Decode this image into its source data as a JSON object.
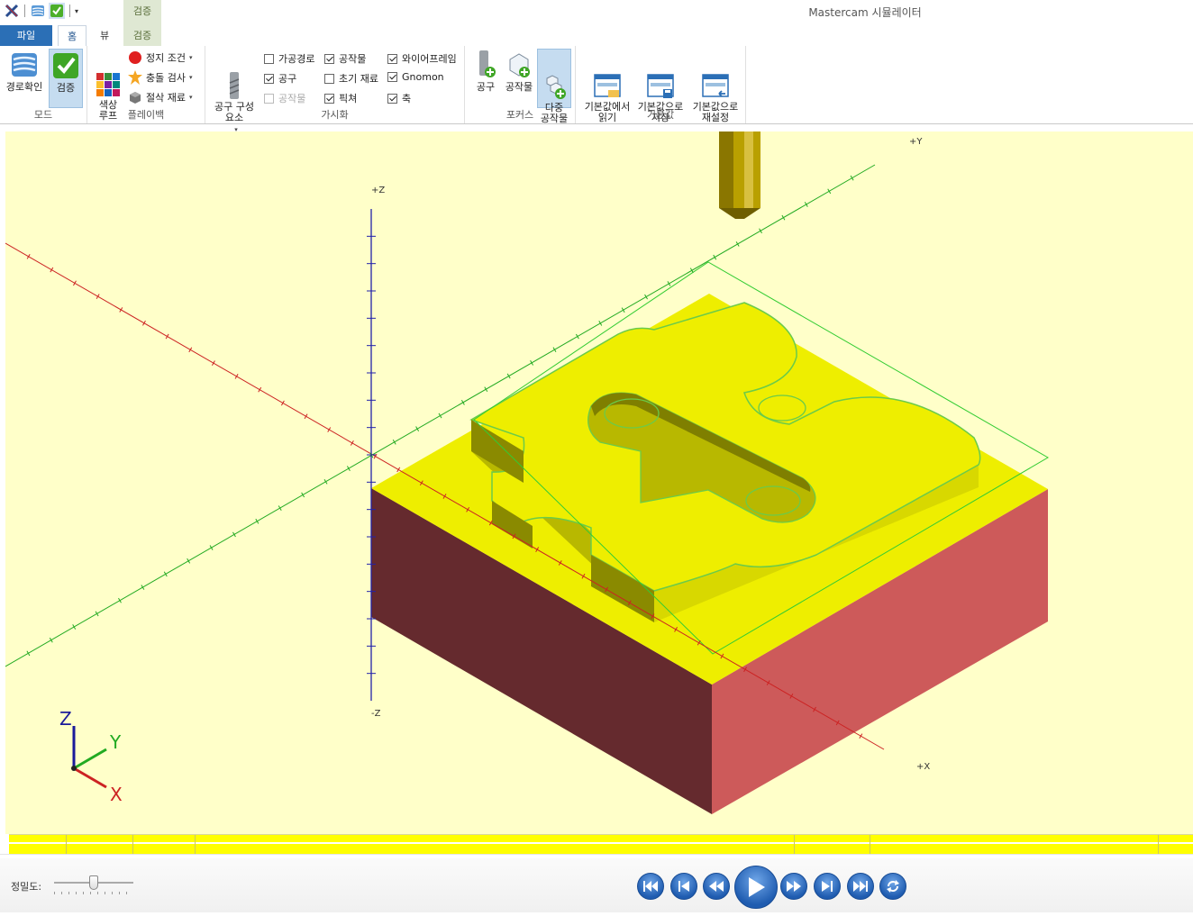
{
  "window": {
    "title": "Mastercam 시뮬레이터",
    "context_tab_header": "검증"
  },
  "tabs": [
    {
      "label": "파일"
    },
    {
      "label": "홈"
    },
    {
      "label": "뷰"
    },
    {
      "label": "검증"
    }
  ],
  "ribbon": {
    "mode": {
      "label": "모드",
      "backplot": "경로확인",
      "verify": "검증"
    },
    "playback": {
      "label": "플레이백",
      "color_loop": "색상\n루프",
      "stop_conditions": "정지 조건",
      "collision_check": "충돌 검사",
      "cut_stock": "절삭 재료"
    },
    "visibility": {
      "label": "가시화",
      "tool_components": "공구 구성\n요소",
      "toolpath": "가공경로",
      "workpiece": "공작물",
      "wireframe": "와이어프레임",
      "tool": "공구",
      "initial_stock": "초기 재료",
      "gnomon": "Gnomon",
      "workpiece2": "공작물",
      "fixture": "픽쳐",
      "axes": "축"
    },
    "focus": {
      "label": "포커스",
      "tool": "공구",
      "workpiece": "공작물",
      "multi_workpiece": "다중\n공작물"
    },
    "defaults": {
      "label": "기본값",
      "load": "기본값에서\n읽기",
      "save": "기본값으로\n저장",
      "reset": "기본값으로\n재설정"
    }
  },
  "viewport": {
    "axis_pos_y": "+Y",
    "axis_pos_z": "+Z",
    "axis_neg_z": "-Z",
    "axis_pos_x": "+X",
    "gnomon_z": "Z",
    "gnomon_y": "Y",
    "gnomon_x": "X"
  },
  "bottom": {
    "precision_label": "정밀도:",
    "precision_level": 0.5
  },
  "colors": {
    "viewport_bg": "#ffffc9",
    "stock_top": "#eeee00",
    "stock_left": "#652a2e",
    "stock_right": "#cd5a5a",
    "x_axis": "#cc2222",
    "y_axis": "#22aa22",
    "z_axis": "#2222aa",
    "ribbon_file_tab": "#2b6fb6"
  }
}
